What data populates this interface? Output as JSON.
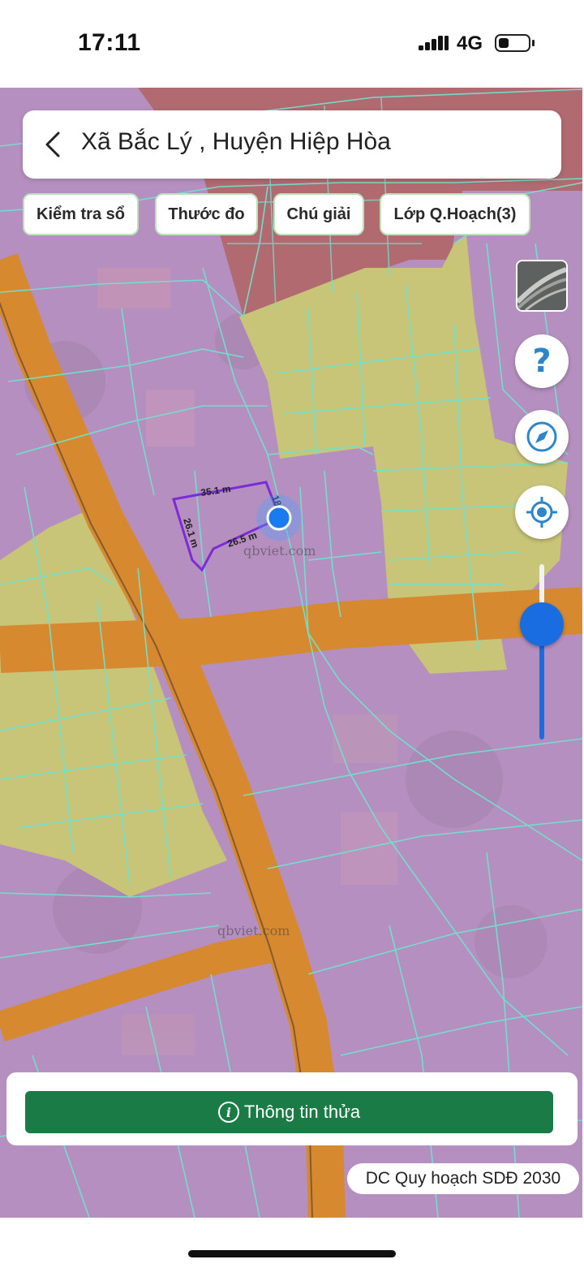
{
  "status": {
    "time": "17:11",
    "network": "4G",
    "battery_level": 0.25
  },
  "header": {
    "title": "Xã Bắc Lý , Huyện Hiệp Hòa"
  },
  "chips": [
    {
      "label": "Kiểm tra sổ"
    },
    {
      "label": "Thước đo"
    },
    {
      "label": "Chú giải"
    },
    {
      "label": "Lớp Q.Hoạch(3)"
    }
  ],
  "controls": {
    "help_label": "?",
    "zoom_level": 0.65
  },
  "map": {
    "measurements": [
      "35.1 m",
      "18",
      "26.1 m",
      "26.5 m"
    ],
    "watermark": "qbviet.com",
    "colors": {
      "residential": "#b58fbf",
      "agriculture": "#c8c478",
      "road": "#d6892f",
      "parcel_line": "#6fe3cf",
      "measure_line": "#7d2bd6",
      "location_dot": "#1a7bf0"
    }
  },
  "bottom": {
    "info_button_label": "Thông tin thửa",
    "info_icon": "i",
    "plan_label": "DC Quy hoạch SDĐ 2030"
  }
}
